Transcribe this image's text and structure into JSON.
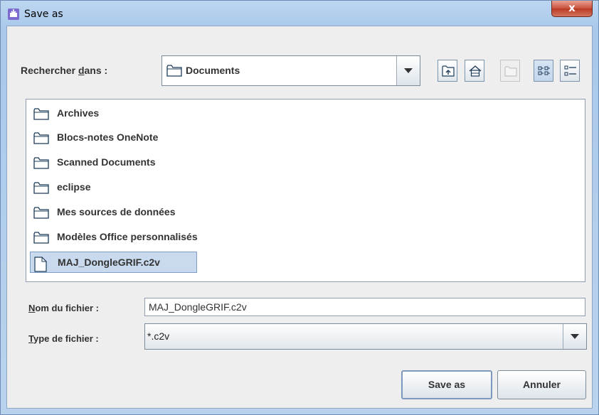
{
  "window": {
    "title": "Save as",
    "close_glyph": "x"
  },
  "lookin": {
    "label_pre": "Rechercher ",
    "label_mnemonic": "d",
    "label_post": "ans :",
    "value": "Documents"
  },
  "toolbar": {
    "icons": [
      "up-folder-icon",
      "home-icon",
      "new-folder-icon",
      "list-view-icon",
      "details-view-icon"
    ]
  },
  "files": [
    {
      "name": "Archives",
      "type": "folder"
    },
    {
      "name": "Blocs-notes OneNote",
      "type": "folder"
    },
    {
      "name": "Scanned Documents",
      "type": "folder"
    },
    {
      "name": "eclipse",
      "type": "folder"
    },
    {
      "name": "Mes sources de données",
      "type": "folder"
    },
    {
      "name": "Modèles Office personnalisés",
      "type": "folder"
    },
    {
      "name": "MAJ_DongleGRIF.c2v",
      "type": "file",
      "selected": true
    }
  ],
  "filename": {
    "label_mnemonic": "N",
    "label_post": "om du fichier :",
    "value": "MAJ_DongleGRIF.c2v"
  },
  "filetype": {
    "label_mnemonic": "T",
    "label_post": "ype de fichier :",
    "value": "*.c2v"
  },
  "buttons": {
    "save": "Save as",
    "cancel": "Annuler"
  },
  "colors": {
    "frame": "#a9c8ea",
    "close": "#c9503c",
    "selection": "#c9daee"
  }
}
